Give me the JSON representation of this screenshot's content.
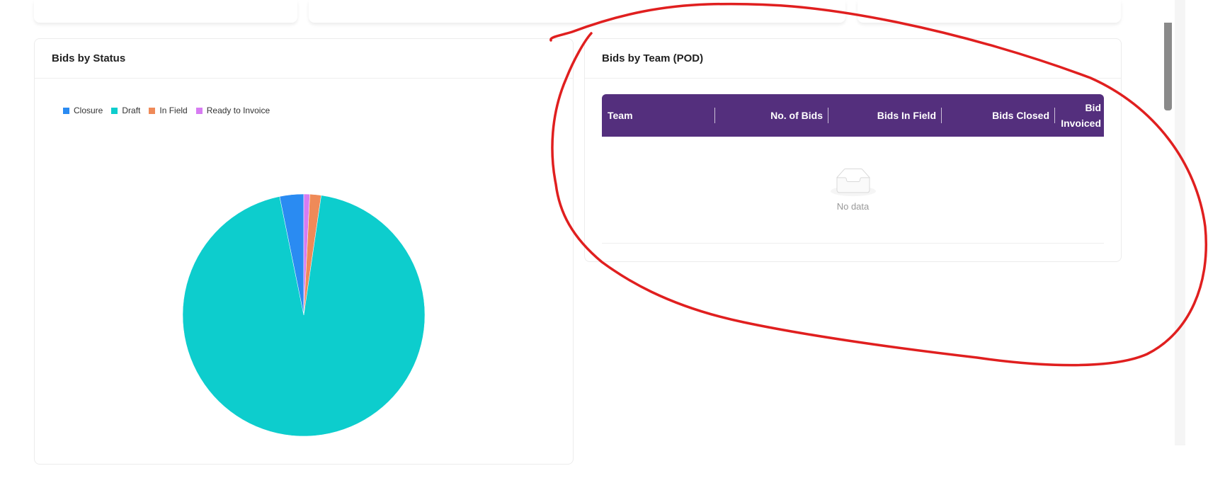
{
  "left_panel": {
    "title": "Bids by Status",
    "legend": [
      {
        "label": "Closure",
        "color": "#2a8bf2"
      },
      {
        "label": "Draft",
        "color": "#0dcdcd"
      },
      {
        "label": "In Field",
        "color": "#ef8a58"
      },
      {
        "label": "Ready to Invoice",
        "color": "#d77cf2"
      }
    ]
  },
  "right_panel": {
    "title": "Bids by Team (POD)",
    "columns": [
      "Team",
      "No. of Bids",
      "Bids In Field",
      "Bids Closed",
      "Bid Invoiced"
    ],
    "empty_text": "No data",
    "header_color": "#542f7d"
  },
  "chart_data": {
    "type": "pie",
    "categories": [
      "Closure",
      "Draft",
      "In Field",
      "Ready to Invoice"
    ],
    "values": [
      3.2,
      94.3,
      1.5,
      0.8
    ],
    "colors": [
      "#2a8bf2",
      "#0dcdcd",
      "#ef8a58",
      "#d77cf2"
    ],
    "legend_position": "top-left"
  }
}
